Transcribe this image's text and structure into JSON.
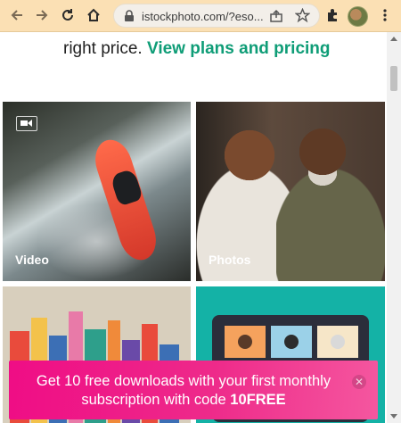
{
  "browser": {
    "url": "istockphoto.com/?eso...",
    "icons": {
      "back": "arrow-left-icon",
      "forward": "arrow-right-icon",
      "reload": "reload-icon",
      "home": "home-icon",
      "lock": "lock-icon",
      "share": "share-icon",
      "bookmark": "star-icon",
      "extensions": "puzzle-icon",
      "menu": "kebab-menu-icon"
    }
  },
  "promo": {
    "text_prefix": "right price.",
    "link_label": "View plans and pricing"
  },
  "tiles": [
    {
      "label": "Video",
      "icon": "video-camera-icon"
    },
    {
      "label": "Photos"
    }
  ],
  "banner": {
    "text": "Get 10 free downloads with your first monthly subscription with code",
    "code": "10FREE",
    "close_icon": "close-icon"
  },
  "colors": {
    "toolbar": "#fbe0b4",
    "link": "#0f9d77",
    "banner": "#ef0d85"
  }
}
